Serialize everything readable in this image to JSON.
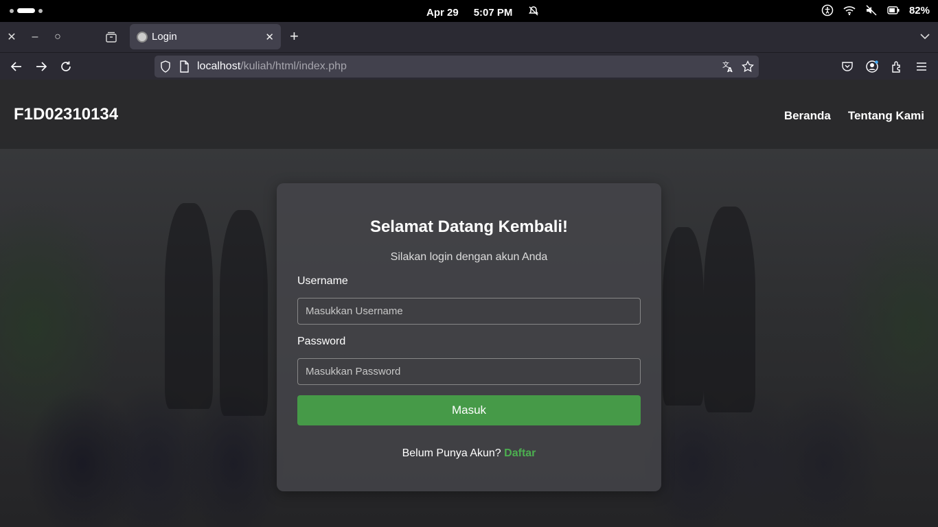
{
  "status_bar": {
    "date": "Apr 29",
    "time": "5:07 PM",
    "battery": "82%"
  },
  "browser": {
    "tab_title": "Login",
    "url_host": "localhost",
    "url_path": "/kuliah/html/index.php"
  },
  "site": {
    "brand": "F1D02310134",
    "nav": [
      "Beranda",
      "Tentang Kami"
    ]
  },
  "login": {
    "title": "Selamat Datang Kembali!",
    "subtitle": "Silakan login dengan akun Anda",
    "username_label": "Username",
    "username_placeholder": "Masukkan Username",
    "password_label": "Password",
    "password_placeholder": "Masukkan Password",
    "submit_label": "Masuk",
    "register_prompt": "Belum Punya Akun?",
    "register_link": "Daftar"
  },
  "colors": {
    "accent": "#469a48",
    "link": "#4caf50"
  }
}
